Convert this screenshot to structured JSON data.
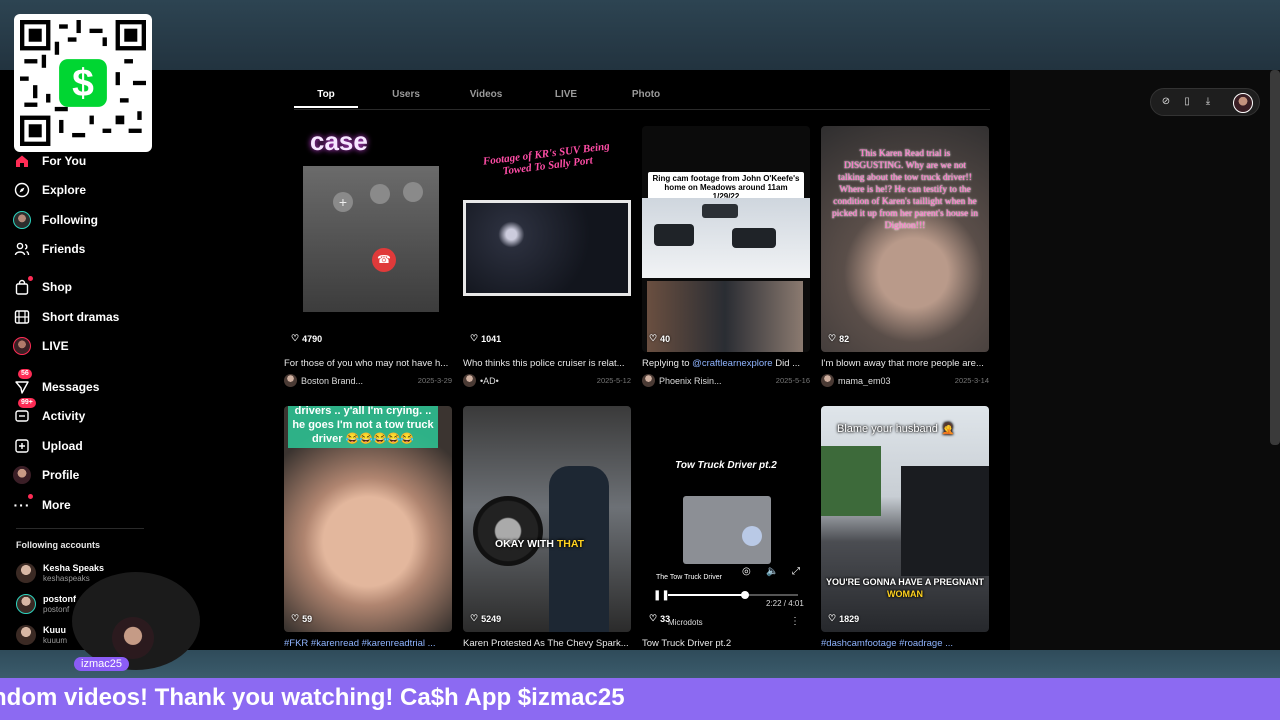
{
  "qr": {
    "icon": "cash-app-dollar"
  },
  "nav": [
    {
      "label": "For You",
      "icon": "home-icon"
    },
    {
      "label": "Explore",
      "icon": "compass-icon"
    },
    {
      "label": "Following",
      "icon": "following-avatar"
    },
    {
      "label": "Friends",
      "icon": "friends-icon"
    },
    {
      "label": "Shop",
      "icon": "bag-icon"
    },
    {
      "label": "Short dramas",
      "icon": "film-icon"
    },
    {
      "label": "LIVE",
      "icon": "live-avatar"
    },
    {
      "label": "Messages",
      "icon": "messages-icon",
      "badge": "56"
    },
    {
      "label": "Activity",
      "icon": "activity-icon",
      "badge": "99+"
    },
    {
      "label": "Upload",
      "icon": "upload-icon"
    },
    {
      "label": "Profile",
      "icon": "profile-avatar"
    },
    {
      "label": "More",
      "icon": "more-icon"
    }
  ],
  "following_accounts": {
    "heading": "Following accounts",
    "items": [
      {
        "name": "Kesha Speaks",
        "handle": "keshaspeaks"
      },
      {
        "name": "postonf",
        "handle": "postonf"
      },
      {
        "name": "Kuuu",
        "handle": "kuuum"
      }
    ]
  },
  "webcam": {
    "label": "izmac25"
  },
  "tabs": [
    "Top",
    "Users",
    "Videos",
    "LIVE",
    "Photo"
  ],
  "active_tab": "Top",
  "toolbar": {
    "icons": [
      "compass-icon",
      "phone-icon",
      "download-icon",
      "user-avatar"
    ]
  },
  "videos": [
    {
      "likes": "4790",
      "caption": "For those of you who may not have h...",
      "author": "Boston Brand...",
      "date": "2025-3-29",
      "overlay_text": "case"
    },
    {
      "likes": "1041",
      "caption": "Who thinks this police cruiser is relat...",
      "author": "•AD•",
      "date": "2025-5-12",
      "overlay_text": "Footage of KR's SUV Being Towed To Sally Port"
    },
    {
      "likes": "40",
      "caption_prefix": "Replying to ",
      "caption_mention": "@craftlearnexplore",
      "caption_suffix": " Did ...",
      "author": "Phoenix Risin...",
      "date": "2025-5-16",
      "overlay_text": "Ring cam footage from John O'Keefe's home on Meadows around 11am 1/29/22"
    },
    {
      "likes": "82",
      "caption": "I'm blown away that more people are...",
      "author": "mama_em03",
      "date": "2025-3-14",
      "overlay_text": "This Karen Read trial is DISGUSTING. Why are we not talking about the tow truck driver!! Where is he!? He can testify to the condition of Karen's taillight when he picked it up from her parent's house in Dighton!!!"
    },
    {
      "likes": "59",
      "caption": "#FKR #karenread #karenreadtrial ...",
      "caption_is_tags": true,
      "overlay_text": "drivers .. y'all I'm crying. .. he goes I'm not a tow truck driver 😂😂😂😂😂"
    },
    {
      "likes": "5249",
      "caption": "Karen Protested As The Chevy Spark...",
      "overlay_text_a": "OKAY WITH ",
      "overlay_text_b": "THAT"
    },
    {
      "likes": "33",
      "caption": "Tow Truck Driver pt.2",
      "overlay_text": "Tow Truck Driver pt.2",
      "player": {
        "time": "2:22 / 4:01",
        "progress": 0.59,
        "channel": "Microdots",
        "now_playing": "The Tow Truck Driver"
      }
    },
    {
      "likes": "1829",
      "caption": "#dashcamfootage #roadrage ...",
      "caption_is_tags": true,
      "overlay_text": "Blame your husband 🤦",
      "overlay_text_bottom_a": "YOU'RE GONNA HAVE A PREGNANT ",
      "overlay_text_bottom_b": "WOMAN"
    }
  ],
  "ticker": "ndom videos! Thank you watching! Ca$h App $izmac25",
  "colors": {
    "accent": "#fe2c55",
    "ticker_bg": "#8c6af2",
    "mention": "#8fb4ff",
    "top_strip": "#2d4452"
  }
}
